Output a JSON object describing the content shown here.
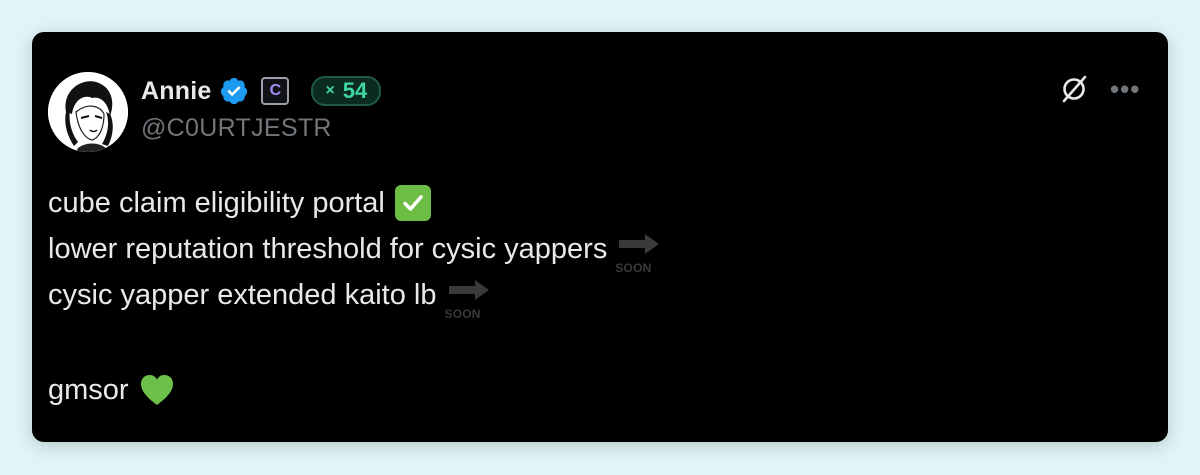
{
  "post": {
    "author": {
      "name": "Annie",
      "handle": "@C0URTJESTR",
      "verified": true,
      "affiliate_badge": "C",
      "score_prefix": "×",
      "score": "54",
      "avatar": "manga-portrait-avatar"
    },
    "lines": [
      {
        "text": "cube claim eligibility portal",
        "emoji": "check-mark-button-icon"
      },
      {
        "text": "lower reputation threshold for cysic yappers",
        "emoji": "soon-arrow-icon",
        "emoji_label": "SOON"
      },
      {
        "text": "cysic yapper extended kaito lb",
        "emoji": "soon-arrow-icon",
        "emoji_label": "SOON"
      },
      {
        "text": "gmsor",
        "emoji": "green-heart-icon"
      }
    ],
    "actions": {
      "grok": "grok-icon",
      "more": "•••"
    }
  },
  "colors": {
    "background": "#dff5f8",
    "card": "#000000",
    "text": "#e7e9ea",
    "muted": "#71767b",
    "verified_blue": "#1d9bf0",
    "score_green": "#3fd6a0",
    "check_green": "#6dbd45",
    "heart_green": "#6cc04a"
  }
}
